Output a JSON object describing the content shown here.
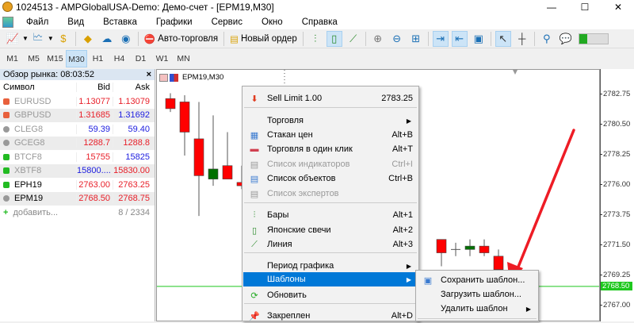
{
  "window": {
    "title": "1024513 - AMPGlobalUSA-Demo: Демо-счет - [EPM19,M30]",
    "minimize": "—",
    "maximize": "☐",
    "close": "✕"
  },
  "menubar": [
    "Файл",
    "Вид",
    "Вставка",
    "Графики",
    "Сервис",
    "Окно",
    "Справка"
  ],
  "toolbar": {
    "auto_trading": "Авто-торговля",
    "new_order": "Новый ордер"
  },
  "timeframes": [
    "M1",
    "M5",
    "M15",
    "M30",
    "H1",
    "H4",
    "D1",
    "W1",
    "MN"
  ],
  "active_timeframe": "M30",
  "market_watch": {
    "title": "Обзор рынка: 08:03:52",
    "close": "×",
    "headers": [
      "Символ",
      "Bid",
      "Ask"
    ],
    "rows": [
      {
        "symbol": "EURUSD",
        "bid": "1.13077",
        "ask": "1.13079",
        "icon": "#e8603c",
        "sym_color": "#999",
        "bid_color": "#e8202a",
        "ask_color": "#e8202a"
      },
      {
        "symbol": "GBPUSD",
        "bid": "1.31685",
        "ask": "1.31692",
        "icon": "#e8603c",
        "sym_color": "#999",
        "bid_color": "#e8202a",
        "ask_color": "#2020e0"
      },
      {
        "symbol": "CLEG8",
        "bid": "59.39",
        "ask": "59.40",
        "icon": "#999",
        "sym_color": "#999",
        "bid_color": "#2020e0",
        "ask_color": "#2020e0"
      },
      {
        "symbol": "GCEG8",
        "bid": "1288.7",
        "ask": "1288.8",
        "icon": "#999",
        "sym_color": "#999",
        "bid_color": "#e8202a",
        "ask_color": "#e8202a"
      },
      {
        "symbol": "BTCF8",
        "bid": "15755",
        "ask": "15825",
        "icon": "#22bb22",
        "sym_color": "#999",
        "bid_color": "#e8202a",
        "ask_color": "#2020e0"
      },
      {
        "symbol": "XBTF8",
        "bid": "15800....",
        "ask": "15830.00",
        "icon": "#22bb22",
        "sym_color": "#999",
        "bid_color": "#2020e0",
        "ask_color": "#e8202a"
      },
      {
        "symbol": "EPH19",
        "bid": "2763.00",
        "ask": "2763.25",
        "icon": "#22bb22",
        "sym_color": "#000",
        "bid_color": "#e8202a",
        "ask_color": "#e8202a"
      },
      {
        "symbol": "EPM19",
        "bid": "2768.50",
        "ask": "2768.75",
        "icon": "#999",
        "sym_color": "#000",
        "bid_color": "#e8202a",
        "ask_color": "#e8202a"
      }
    ],
    "add_label": "добавить...",
    "count": "8 / 2334"
  },
  "chart": {
    "symbol_label": "EPM19,M30",
    "price_ticks": [
      "2782.75",
      "2780.50",
      "2778.25",
      "2776.00",
      "2773.75",
      "2771.50",
      "2769.25",
      "2767.00"
    ],
    "current_price": "2768.50",
    "bull_color": "#007000",
    "bear_color": "#ff0000",
    "line_color": "#1ec81e",
    "candles": [
      {
        "i": 0,
        "o": 2782.5,
        "h": 2782.9,
        "l": 2781.5,
        "c": 2781.75
      },
      {
        "i": 1,
        "o": 2782.25,
        "h": 2782.75,
        "l": 2778.25,
        "c": 2780.0
      },
      {
        "i": 2,
        "o": 2779.5,
        "h": 2782.25,
        "l": 2773.75,
        "c": 2776.75
      },
      {
        "i": 3,
        "o": 2776.5,
        "h": 2781.25,
        "l": 2776.0,
        "c": 2777.25
      },
      {
        "i": 4,
        "o": 2777.5,
        "h": 2780.0,
        "l": 2776.5,
        "c": 2776.5
      },
      {
        "i": 5,
        "o": 2776.25,
        "h": 2777.5,
        "l": 2775.75,
        "c": 2776.0
      },
      {
        "i": 6,
        "o": 2776.0,
        "h": 2776.0,
        "l": 2776.0,
        "c": 2776.0
      },
      {
        "i": 19,
        "o": 2772.0,
        "h": 2772.0,
        "l": 2770.0,
        "c": 2771.0
      },
      {
        "i": 20,
        "o": 2771.25,
        "h": 2771.75,
        "l": 2770.75,
        "c": 2771.25
      },
      {
        "i": 21,
        "o": 2771.25,
        "h": 2772.0,
        "l": 2770.75,
        "c": 2771.5
      },
      {
        "i": 22,
        "o": 2771.5,
        "h": 2772.0,
        "l": 2770.75,
        "c": 2771.0
      },
      {
        "i": 23,
        "o": 2770.75,
        "h": 2771.25,
        "l": 2769.75,
        "c": 2769.75
      }
    ]
  },
  "context_menu": {
    "items": [
      {
        "label": "Sell Limit 1.00",
        "shortcut": "2783.25",
        "icon": "sell-limit-icon"
      },
      {
        "label": "Торговля",
        "submenu": true
      },
      {
        "label": "Стакан цен",
        "shortcut": "Alt+B",
        "icon": "depth-of-market-icon"
      },
      {
        "label": "Торговля в один клик",
        "shortcut": "Alt+T",
        "icon": "one-click-trading-icon"
      },
      {
        "label": "Список индикаторов",
        "shortcut": "Ctrl+I",
        "icon": "indicators-list-icon",
        "disabled": true
      },
      {
        "label": "Список объектов",
        "shortcut": "Ctrl+B",
        "icon": "objects-list-icon"
      },
      {
        "label": "Список экспертов",
        "icon": "experts-list-icon",
        "disabled": true
      },
      {
        "label": "Бары",
        "shortcut": "Alt+1",
        "icon": "bar-chart-icon"
      },
      {
        "label": "Японские свечи",
        "shortcut": "Alt+2",
        "icon": "candlesticks-icon"
      },
      {
        "label": "Линия",
        "shortcut": "Alt+3",
        "icon": "line-chart-icon"
      },
      {
        "label": "Период графика",
        "submenu": true
      },
      {
        "label": "Шаблоны",
        "submenu": true,
        "highlighted": true
      },
      {
        "label": "Обновить",
        "icon": "refresh-icon"
      },
      {
        "label": "Закреплен",
        "shortcut": "Alt+D",
        "icon": "pin-icon"
      }
    ]
  },
  "templates_submenu": {
    "items": [
      {
        "label": "Сохранить шаблон...",
        "icon": "save-template-icon"
      },
      {
        "label": "Загрузить шаблон..."
      },
      {
        "label": "Удалить шаблон",
        "submenu": true
      }
    ]
  },
  "annotation_color": "#ee1c25"
}
